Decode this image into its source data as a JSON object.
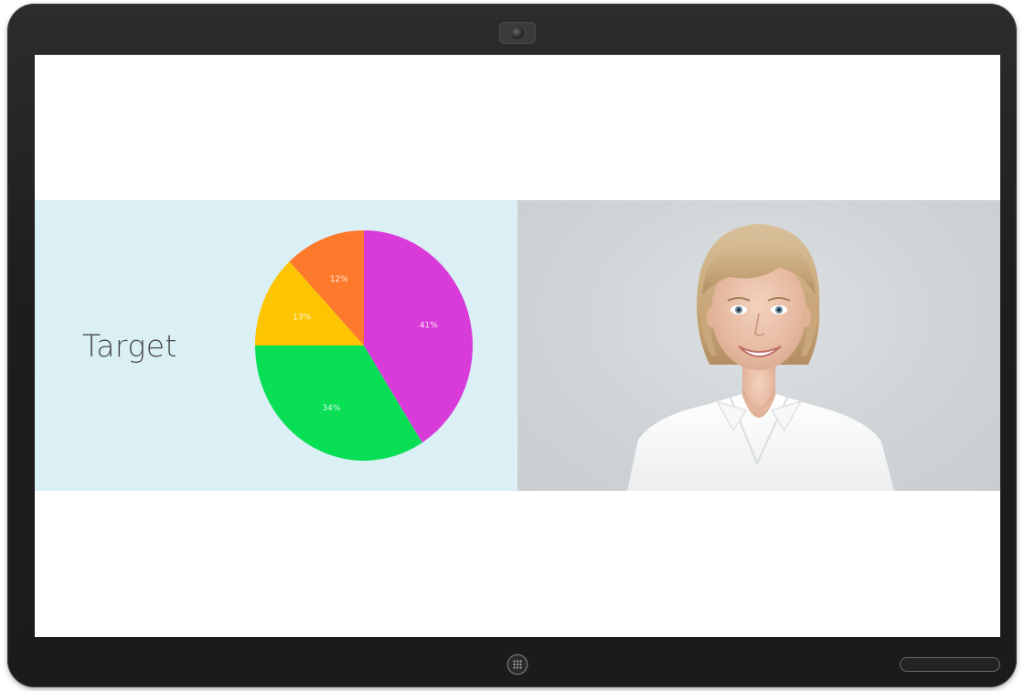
{
  "slide": {
    "heading": "Target",
    "background_color": "#daf0f5"
  },
  "chart_data": {
    "type": "pie",
    "slices": [
      {
        "value": 41,
        "label": "41%",
        "color": "#d93bd9"
      },
      {
        "value": 34,
        "label": "34%",
        "color": "#08df55"
      },
      {
        "value": 13,
        "label": "13%",
        "color": "#fdc402"
      },
      {
        "value": 12,
        "label": "12%",
        "color": "#fd7a2c"
      }
    ],
    "start_angle_deg": 0,
    "direction": "clockwise"
  },
  "device": {
    "icons": {
      "camera": "camera-icon",
      "home": "home-button-icon",
      "speaker": "speaker-grille"
    }
  }
}
